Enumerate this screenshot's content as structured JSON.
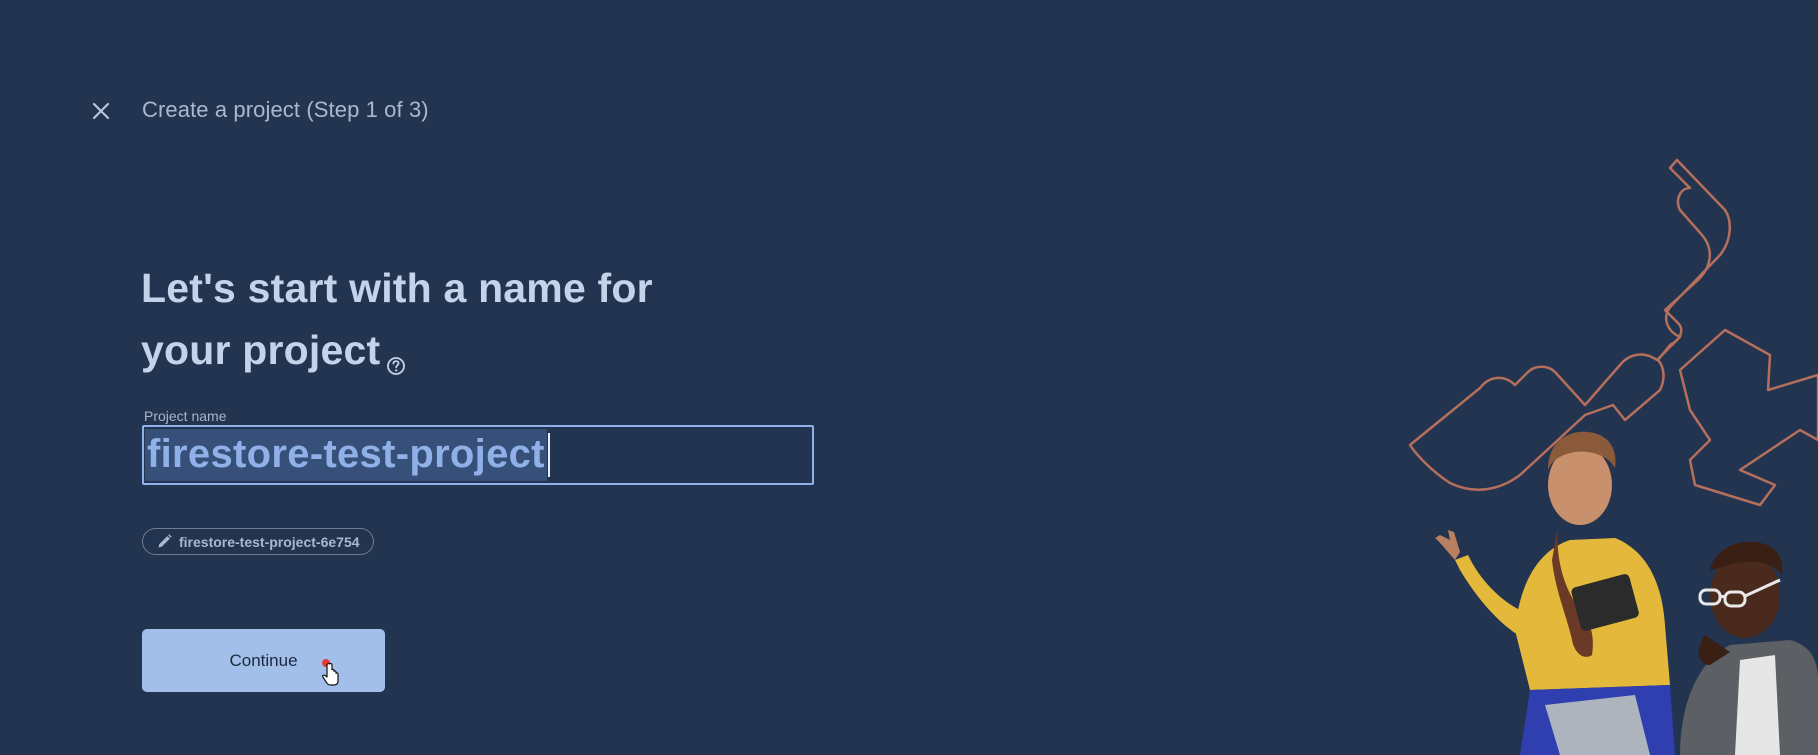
{
  "header": {
    "close_icon": "close-icon",
    "step_title": "Create a project (Step 1 of 3)"
  },
  "main": {
    "heading_line1": "Let's start with a name for",
    "heading_line2": "your project",
    "help_icon": "help-circle-icon",
    "project_name_label": "Project name",
    "project_name_value": "firestore-test-project",
    "project_id_icon": "pencil-icon",
    "project_id": "firestore-test-project-6e754",
    "continue_label": "Continue"
  },
  "colors": {
    "background": "#22344f",
    "accent": "#8fb2ea",
    "button": "#a2bfe9",
    "illustration_outline": "#b56f5c"
  }
}
